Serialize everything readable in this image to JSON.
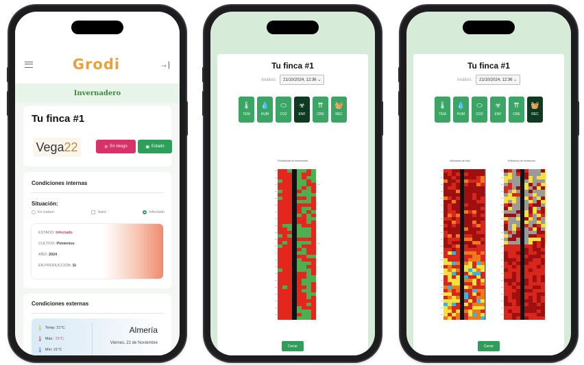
{
  "phone1": {
    "app_name": "Grodi",
    "section": "Invernadero",
    "farm_title": "Tu finca #1",
    "brand_text_a": "Vega",
    "brand_text_b": "22",
    "risk_button": "En riesgo",
    "state_button": "Estado",
    "internal_title": "Condiciones internas",
    "situation_label": "Situación:",
    "radio_options": [
      "En tratam.",
      "Sano",
      "Infectado"
    ],
    "selected_option": "Infectado",
    "info": {
      "estado_label": "ESTADO:",
      "estado_value": "Infectado",
      "cultivo_label": "CULTIVO:",
      "cultivo_value": "Pimientos",
      "ano_label": "AÑO:",
      "ano_value": "2024",
      "produccion_label": "EN PRODUCCIÓN:",
      "produccion_value": "Si"
    },
    "external_title": "Condiciones externas",
    "weather": {
      "temp": "Temp: 21°C",
      "max_label": "Máx:",
      "max_value": "21°C",
      "min": "Mín: 21°C",
      "city": "Almería",
      "date": "Viernes, 22 de Noviembre"
    }
  },
  "modal": {
    "title": "Tu finca #1",
    "analysis_label": "Análisis:",
    "analysis_value": "21/10/2024, 12:36",
    "tiles": [
      {
        "label": "TEM",
        "icon": "thermometer-icon",
        "glyph": "🌡"
      },
      {
        "label": "HUM",
        "icon": "humidity-icon",
        "glyph": "💧"
      },
      {
        "label": "CO2",
        "icon": "co2-icon",
        "glyph": "⬭"
      },
      {
        "label": "ENF",
        "icon": "disease-icon",
        "glyph": "☣"
      },
      {
        "label": "CRE",
        "icon": "growth-icon",
        "glyph": "⇈"
      },
      {
        "label": "REC",
        "icon": "harvest-basket-icon",
        "glyph": "🧺"
      }
    ],
    "close_button": "Cerrar"
  },
  "phone2": {
    "selected_tile": "ENF",
    "plot_title": "Probabilidad de enfermedad",
    "colors": {
      "red": "#e3271c",
      "green": "#4caf50"
    }
  },
  "phone3": {
    "selected_tile": "REC",
    "plot1_title": "Estimación de fruto",
    "plot2_title": "Estimación de recolección",
    "colors": {
      "dark_red": "#9e0f0f",
      "red": "#d9261c",
      "orange": "#f07a1a",
      "yellow": "#f6e03a",
      "grey": "#9a9a9a",
      "cyan": "#35b7e6"
    }
  }
}
